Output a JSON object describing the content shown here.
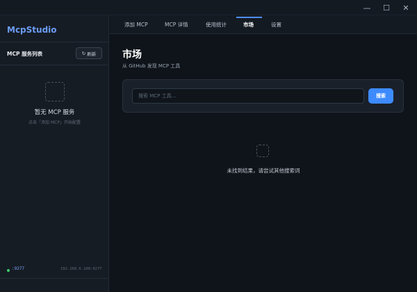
{
  "app": {
    "name": "McpStudio"
  },
  "window_controls": {
    "minimize": "—",
    "maximize": "☐",
    "close": "✕"
  },
  "sidebar": {
    "list_title": "MCP 服务列表",
    "refresh_label": "刷新",
    "refresh_icon": "↻",
    "empty_title": "暂无 MCP 服务",
    "empty_hint": "点击「添加 MCP」开始配置",
    "footer": {
      "port": ":9277",
      "address": "192.168.6.100:9277",
      "status_color": "#3ccf6c"
    }
  },
  "tabs": [
    {
      "label": "添加 MCP",
      "active": false
    },
    {
      "label": "MCP 详情",
      "active": false
    },
    {
      "label": "使用统计",
      "active": false
    },
    {
      "label": "市场",
      "active": true
    },
    {
      "label": "设置",
      "active": false
    }
  ],
  "market": {
    "title": "市场",
    "subtitle": "从 GitHub 发现 MCP 工具",
    "search": {
      "placeholder": "搜索 MCP 工具...",
      "value": "",
      "button_label": "搜索"
    },
    "empty_message": "未找到结果，请尝试其他搜索词"
  },
  "colors": {
    "accent": "#3d8bff",
    "brand": "#6b9df5",
    "background": "#0f141b"
  }
}
